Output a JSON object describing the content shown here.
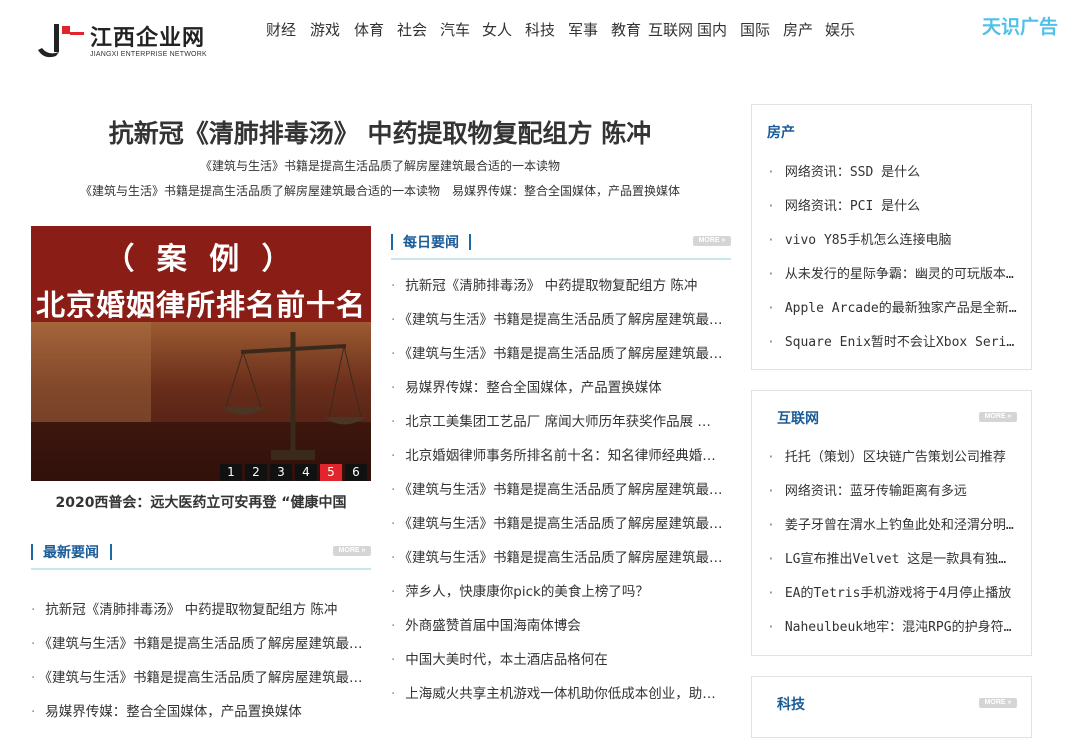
{
  "site": {
    "logo_text": "江西企业网",
    "logo_sub": "JIANGXI ENTERPRISE NETWORK",
    "ad_label": "天识广告"
  },
  "nav": [
    "财经",
    "游戏",
    "体育",
    "社会",
    "汽车",
    "女人",
    "科技",
    "军事",
    "教育",
    "互联网",
    "国内",
    "国际",
    "房产",
    "娱乐"
  ],
  "headline": {
    "title": "抗新冠《清肺排毒汤》 中药提取物复配组方 陈冲",
    "sub1": "《建筑与生活》书籍是提高生活品质了解房屋建筑最合适的一本读物",
    "sub2": "《建筑与生活》书籍是提高生活品质了解房屋建筑最合适的一本读物　易媒界传媒：整合全国媒体，产品置换媒体"
  },
  "slider": {
    "case_text": "（ 案 例 ）",
    "title_text": "北京婚姻律所排名前十名",
    "pages": [
      "1",
      "2",
      "3",
      "4",
      "5",
      "6"
    ],
    "active_page": "5",
    "caption": "2020西普会：远大医药立可安再登 “健康中国"
  },
  "more_label": "MORE »",
  "latest": {
    "title": "最新要闻",
    "items": [
      "抗新冠《清肺排毒汤》 中药提取物复配组方 陈冲",
      "《建筑与生活》书籍是提高生活品质了解房屋建筑最合适的一本读物",
      "《建筑与生活》书籍是提高生活品质了解房屋建筑最合适的一本读物",
      "易媒界传媒：整合全国媒体，产品置换媒体"
    ]
  },
  "daily": {
    "title": "每日要闻",
    "items": [
      "抗新冠《清肺排毒汤》 中药提取物复配组方 陈冲",
      "《建筑与生活》书籍是提高生活品质了解房屋建筑最合适的一本读物",
      "《建筑与生活》书籍是提高生活品质了解房屋建筑最合适的一本读物",
      "易媒界传媒：整合全国媒体，产品置换媒体",
      "北京工美集团工艺品厂 席闻大师历年获奖作品展 …",
      "北京婚姻律师事务所排名前十名：知名律师经典婚姻案例",
      "《建筑与生活》书籍是提高生活品质了解房屋建筑最合适的一本读物",
      "《建筑与生活》书籍是提高生活品质了解房屋建筑最合适的一本读物",
      "《建筑与生活》书籍是提高生活品质了解房屋建筑最合适的一本读物",
      "萍乡人，快康康你pick的美食上榜了吗？",
      "外商盛赞首届中国海南体博会",
      "中国大美时代，本土酒店品格何在",
      "上海威火共享主机游戏一体机助你低成本创业，助力创业者"
    ]
  },
  "side_fangchan": {
    "title": "房产",
    "items": [
      "网络资讯：SSD 是什么",
      "网络资讯：PCI 是什么",
      "vivo Y85手机怎么连接电脑",
      "从未发行的星际争霸：幽灵的可玩版本出现",
      "Apple Arcade的最新独家产品是全新游戏",
      "Square Enix暂时不会让Xbox Series X兼容"
    ]
  },
  "side_hulianwang": {
    "title": "互联网",
    "items": [
      "托托（策划）区块链广告策划公司推荐",
      "网络资讯：蓝牙传输距离有多远",
      "姜子牙曾在渭水上钓鱼此处和泾渭分明有关",
      "LG宣布推出Velvet 这是一款具有独特设计的手机",
      "EA的Tetris手机游戏将于4月停止播放",
      "Naheulbeuk地牢：混沌RPG的护身符发布"
    ]
  },
  "side_keji": {
    "title": "科技"
  }
}
